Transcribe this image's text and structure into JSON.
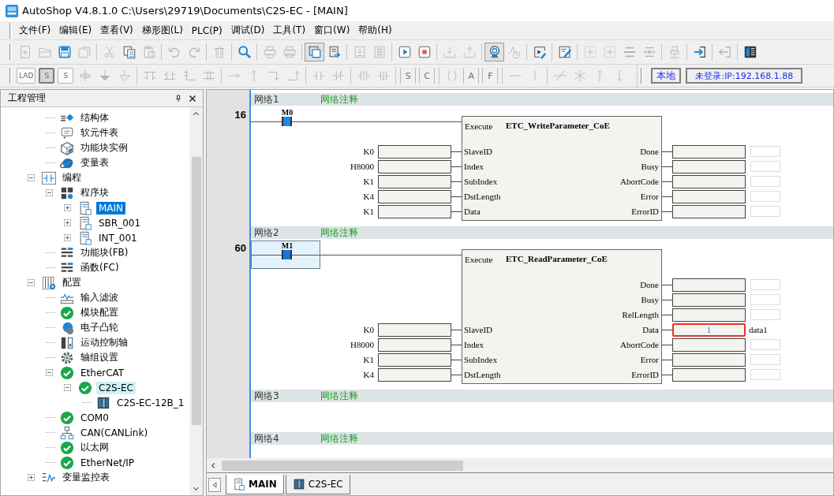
{
  "window": {
    "title": "AutoShop V4.8.1.0  C:\\Users\\29719\\Documents\\C2S-EC - [MAIN]"
  },
  "menu": [
    "文件(F)",
    "编辑(E)",
    "查看(V)",
    "梯形图(L)",
    "PLC(P)",
    "调试(D)",
    "工具(T)",
    "窗口(W)",
    "帮助(H)"
  ],
  "toolbar_1": [
    {
      "kind": "document-plus",
      "disabled": true,
      "pressed": false
    },
    {
      "kind": "folder",
      "disabled": true,
      "pressed": false
    },
    {
      "kind": "floppy",
      "disabled": false,
      "pressed": false
    },
    {
      "kind": "stacked-disks",
      "disabled": true,
      "pressed": false
    },
    {
      "kind": "separator"
    },
    {
      "kind": "scissors",
      "disabled": true,
      "pressed": false
    },
    {
      "kind": "copy",
      "disabled": false,
      "pressed": false
    },
    {
      "kind": "clipboard",
      "disabled": true,
      "pressed": false
    },
    {
      "kind": "separator"
    },
    {
      "kind": "undo",
      "disabled": true,
      "pressed": false
    },
    {
      "kind": "redo",
      "disabled": true,
      "pressed": false
    },
    {
      "kind": "separator"
    },
    {
      "kind": "trash",
      "disabled": true,
      "pressed": false
    },
    {
      "kind": "separator"
    },
    {
      "kind": "search",
      "disabled": false,
      "pressed": false
    },
    {
      "kind": "separator"
    },
    {
      "kind": "printer-eye",
      "disabled": true,
      "pressed": false
    },
    {
      "kind": "printer",
      "disabled": true,
      "pressed": false
    },
    {
      "kind": "separator"
    },
    {
      "kind": "windows",
      "disabled": false,
      "pressed": true
    },
    {
      "kind": "document-arrow",
      "disabled": false,
      "pressed": false
    },
    {
      "kind": "separator"
    },
    {
      "kind": "document-download",
      "disabled": true,
      "pressed": false
    },
    {
      "kind": "document-grid",
      "disabled": true,
      "pressed": false
    },
    {
      "kind": "separator"
    },
    {
      "kind": "play",
      "disabled": false,
      "pressed": false
    },
    {
      "kind": "stop",
      "disabled": false,
      "pressed": false
    },
    {
      "kind": "separator"
    },
    {
      "kind": "tray-download",
      "disabled": true,
      "pressed": false
    },
    {
      "kind": "tray-upload",
      "disabled": true,
      "pressed": false
    },
    {
      "kind": "separator"
    },
    {
      "kind": "webcam",
      "disabled": false,
      "pressed": true
    },
    {
      "kind": "chart-clock",
      "disabled": true,
      "pressed": false
    },
    {
      "kind": "separator"
    },
    {
      "kind": "play-pencil",
      "disabled": false,
      "pressed": false
    },
    {
      "kind": "separator"
    },
    {
      "kind": "note-pencil",
      "disabled": false,
      "pressed": false
    },
    {
      "kind": "separator"
    },
    {
      "kind": "dotted-box",
      "disabled": true,
      "pressed": false
    },
    {
      "kind": "dotted-box",
      "disabled": true,
      "pressed": false
    },
    {
      "kind": "bars",
      "disabled": true,
      "pressed": false
    },
    {
      "kind": "crossed-bars",
      "disabled": true,
      "pressed": false
    },
    {
      "kind": "separator"
    },
    {
      "kind": "plug",
      "disabled": true,
      "pressed": false
    },
    {
      "kind": "separator"
    },
    {
      "kind": "arrow-in",
      "disabled": false,
      "pressed": false
    },
    {
      "kind": "separator"
    },
    {
      "kind": "arrow-out",
      "disabled": true,
      "pressed": false
    },
    {
      "kind": "separator"
    },
    {
      "kind": "panel",
      "disabled": false,
      "pressed": false
    }
  ],
  "toolbar_2": [
    {
      "kind": "glyph-box",
      "glyph": "LAD",
      "disabled": true,
      "pressed": false
    },
    {
      "kind": "glyph-box",
      "glyph": "S",
      "disabled": true,
      "pressed": true
    },
    {
      "kind": "glyph-box",
      "glyph": "S",
      "disabled": true,
      "pressed": false
    },
    {
      "kind": "junction",
      "disabled": true,
      "pressed": false
    },
    {
      "kind": "down-arrow-filled",
      "disabled": true,
      "pressed": false
    },
    {
      "kind": "down-triangle",
      "disabled": true,
      "pressed": false
    },
    {
      "kind": "separator"
    },
    {
      "kind": "branch",
      "disabled": true,
      "pressed": false
    },
    {
      "kind": "branch-up",
      "disabled": true,
      "pressed": false
    },
    {
      "kind": "branch-step",
      "disabled": true,
      "pressed": false
    },
    {
      "kind": "branch-split",
      "disabled": true,
      "pressed": false
    },
    {
      "kind": "separator"
    },
    {
      "kind": "right-arrow",
      "disabled": true,
      "pressed": false
    },
    {
      "kind": "up-arrow",
      "disabled": true,
      "pressed": false
    },
    {
      "kind": "corner-down",
      "disabled": true,
      "pressed": false
    },
    {
      "kind": "corner-up",
      "disabled": true,
      "pressed": false
    },
    {
      "kind": "separator"
    },
    {
      "kind": "contact",
      "disabled": true,
      "pressed": false
    },
    {
      "kind": "contact-slash",
      "disabled": true,
      "pressed": false
    },
    {
      "kind": "separator"
    },
    {
      "kind": "contact-up",
      "disabled": true,
      "pressed": false
    },
    {
      "kind": "contact-down",
      "disabled": true,
      "pressed": false
    },
    {
      "kind": "separator"
    },
    {
      "kind": "glyph-bracket",
      "glyph": "S",
      "disabled": true,
      "pressed": false
    },
    {
      "kind": "glyph-bracket",
      "glyph": "C",
      "disabled": true,
      "pressed": false
    },
    {
      "kind": "separator"
    },
    {
      "kind": "parens",
      "disabled": true,
      "pressed": false
    },
    {
      "kind": "glyph-bracket",
      "glyph": "A",
      "disabled": true,
      "pressed": false
    },
    {
      "kind": "glyph-bracket",
      "glyph": "F",
      "disabled": true,
      "pressed": false
    },
    {
      "kind": "separator"
    },
    {
      "kind": "h-line",
      "disabled": true,
      "pressed": false
    },
    {
      "kind": "v-line",
      "disabled": true,
      "pressed": false
    },
    {
      "kind": "separator"
    },
    {
      "kind": "slash-line",
      "disabled": true,
      "pressed": false
    },
    {
      "kind": "star-line",
      "disabled": true,
      "pressed": false
    },
    {
      "kind": "up-arrow",
      "disabled": true,
      "pressed": false
    },
    {
      "kind": "down-arrow",
      "disabled": true,
      "pressed": false
    }
  ],
  "connection": {
    "mode": "本地",
    "status": "未登录:IP:192.168.1.88"
  },
  "project_panel": {
    "title": "工程管理",
    "tree_partial": [
      {
        "label": "结构体",
        "kind": "struct",
        "selected": false,
        "highlighted": false
      },
      {
        "label": "软元件表",
        "kind": "message",
        "selected": false,
        "highlighted": false
      },
      {
        "label": "功能块实例",
        "kind": "cube",
        "selected": false,
        "highlighted": false
      },
      {
        "label": "变量表",
        "kind": "globe",
        "selected": false,
        "highlighted": false
      }
    ],
    "tree": [
      {
        "label": "编程",
        "kind": "ladder",
        "expanded": true,
        "selected": false,
        "highlighted": false,
        "children": [
          {
            "label": "程序块",
            "kind": "blocks",
            "expanded": true,
            "selected": false,
            "highlighted": false,
            "children": [
              {
                "label": "MAIN",
                "kind": "document",
                "expanded": false,
                "selected": true,
                "highlighted": false
              },
              {
                "label": "SBR_001",
                "kind": "document",
                "expanded": false,
                "selected": false,
                "highlighted": false
              },
              {
                "label": "INT_001",
                "kind": "document",
                "expanded": false,
                "selected": false,
                "highlighted": false
              }
            ]
          },
          {
            "label": "功能块(FB)",
            "kind": "list",
            "selected": false,
            "highlighted": false
          },
          {
            "label": "函数(FC)",
            "kind": "list",
            "selected": false,
            "highlighted": false
          }
        ]
      },
      {
        "label": "配置",
        "kind": "config",
        "expanded": true,
        "selected": false,
        "highlighted": false,
        "children": [
          {
            "label": "输入滤波",
            "kind": "wave",
            "selected": false,
            "highlighted": false
          },
          {
            "label": "模块配置",
            "kind": "check",
            "selected": false,
            "highlighted": false
          },
          {
            "label": "电子凸轮",
            "kind": "disc",
            "selected": false,
            "highlighted": false
          },
          {
            "label": "运动控制轴",
            "kind": "axis",
            "selected": false,
            "highlighted": false
          },
          {
            "label": "轴组设置",
            "kind": "gear",
            "selected": false,
            "highlighted": false
          },
          {
            "label": "EtherCAT",
            "kind": "check",
            "expanded": true,
            "selected": false,
            "highlighted": false,
            "children": [
              {
                "label": "C2S-EC",
                "kind": "check",
                "expanded": true,
                "selected": false,
                "highlighted": true,
                "children": [
                  {
                    "label": "C2S-EC-12B_1",
                    "kind": "device",
                    "selected": false,
                    "highlighted": false
                  }
                ]
              }
            ]
          },
          {
            "label": "COM0",
            "kind": "check",
            "selected": false,
            "highlighted": false
          },
          {
            "label": "CAN(CANLink)",
            "kind": "network",
            "selected": false,
            "highlighted": false
          },
          {
            "label": "以太网",
            "kind": "check",
            "selected": false,
            "highlighted": false
          },
          {
            "label": "EtherNet/IP",
            "kind": "check",
            "selected": false,
            "highlighted": false
          }
        ]
      },
      {
        "label": "变量监控表",
        "kind": "monitor",
        "expanded": false,
        "selected": false,
        "highlighted": false
      }
    ]
  },
  "editor": {
    "networks": [
      {
        "label": "网络1",
        "comment": "网络注释",
        "line_number": "16",
        "contact": {
          "label": "M0",
          "selected": false
        },
        "block": {
          "enable_pin": "Execute",
          "name": "ETC_WriteParameter_CoE",
          "inputs": [
            {
              "operand": "K0",
              "pin": "SlaveID"
            },
            {
              "operand": "H8000",
              "pin": "Index"
            },
            {
              "operand": "K1",
              "pin": "SubIndex"
            },
            {
              "operand": "K4",
              "pin": "DstLength"
            },
            {
              "operand": "K1",
              "pin": "Data"
            }
          ],
          "outputs": [
            {
              "pin": "Done",
              "highlighted": false
            },
            {
              "pin": "Busy",
              "highlighted": false
            },
            {
              "pin": "AbortCode",
              "highlighted": false
            },
            {
              "pin": "Error",
              "highlighted": false
            },
            {
              "pin": "ErrorID",
              "highlighted": false
            }
          ]
        }
      },
      {
        "label": "网络2",
        "comment": "网络注释",
        "line_number": "60",
        "contact": {
          "label": "M1",
          "selected": true
        },
        "block": {
          "enable_pin": "Execute",
          "name": "ETC_ReadParameter_CoE",
          "inputs": [
            {
              "operand": "K0",
              "pin": "SlaveID"
            },
            {
              "operand": "H8000",
              "pin": "Index"
            },
            {
              "operand": "K1",
              "pin": "SubIndex"
            },
            {
              "operand": "K4",
              "pin": "DstLength"
            }
          ],
          "outputs": [
            {
              "pin": "Done",
              "highlighted": false
            },
            {
              "pin": "Busy",
              "highlighted": false
            },
            {
              "pin": "RelLength",
              "highlighted": false
            },
            {
              "pin": "Data",
              "value": "1",
              "comment": "data1",
              "highlighted": true
            },
            {
              "pin": "AbortCode",
              "highlighted": false
            },
            {
              "pin": "Error",
              "highlighted": false
            },
            {
              "pin": "ErrorID",
              "highlighted": false
            }
          ]
        }
      },
      {
        "label": "网络3",
        "comment": "网络注释"
      },
      {
        "label": "网络4",
        "comment": "网络注释"
      }
    ],
    "tabs": [
      {
        "label": "MAIN",
        "kind": "document",
        "selected": true
      },
      {
        "label": "C2S-EC",
        "kind": "device",
        "selected": false
      }
    ]
  }
}
